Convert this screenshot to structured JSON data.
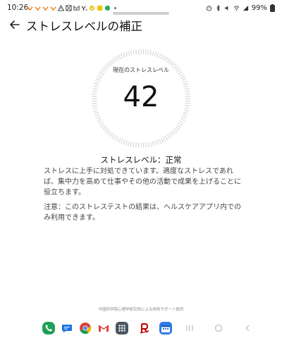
{
  "status_bar": {
    "time": "10:26",
    "battery": "99%"
  },
  "header": {
    "title": "ストレスレベルの補正"
  },
  "gauge": {
    "label": "現在のストレスレベル",
    "value": "42"
  },
  "result": {
    "title": "ストレスレベル：正常",
    "description": "ストレスに上手に対処できています。適度なストレスであれば、集中力を高めて仕事やその他の活動で成果を上げることに役立ちます。",
    "note": "注意：このストレステストの結果は、ヘルスケアアプリ内でのみ利用できます。"
  },
  "footer": {
    "credit": "中国科学院心理学研究所による技術サポート提供"
  },
  "dock": {
    "apps": [
      "phone-app-icon",
      "messages-app-icon",
      "chrome-app-icon",
      "gmail-app-icon",
      "app-drawer-icon",
      "rakuten-app-icon",
      "calendar-app-icon"
    ]
  },
  "colors": {
    "gauge_ring": "#d0d0d0",
    "text_primary": "#111111",
    "text_secondary": "#444444",
    "phone_green": "#1fa05a",
    "messages_blue": "#1a73e8",
    "rakuten_red": "#bf0000",
    "calendar_blue": "#2d7be6"
  }
}
